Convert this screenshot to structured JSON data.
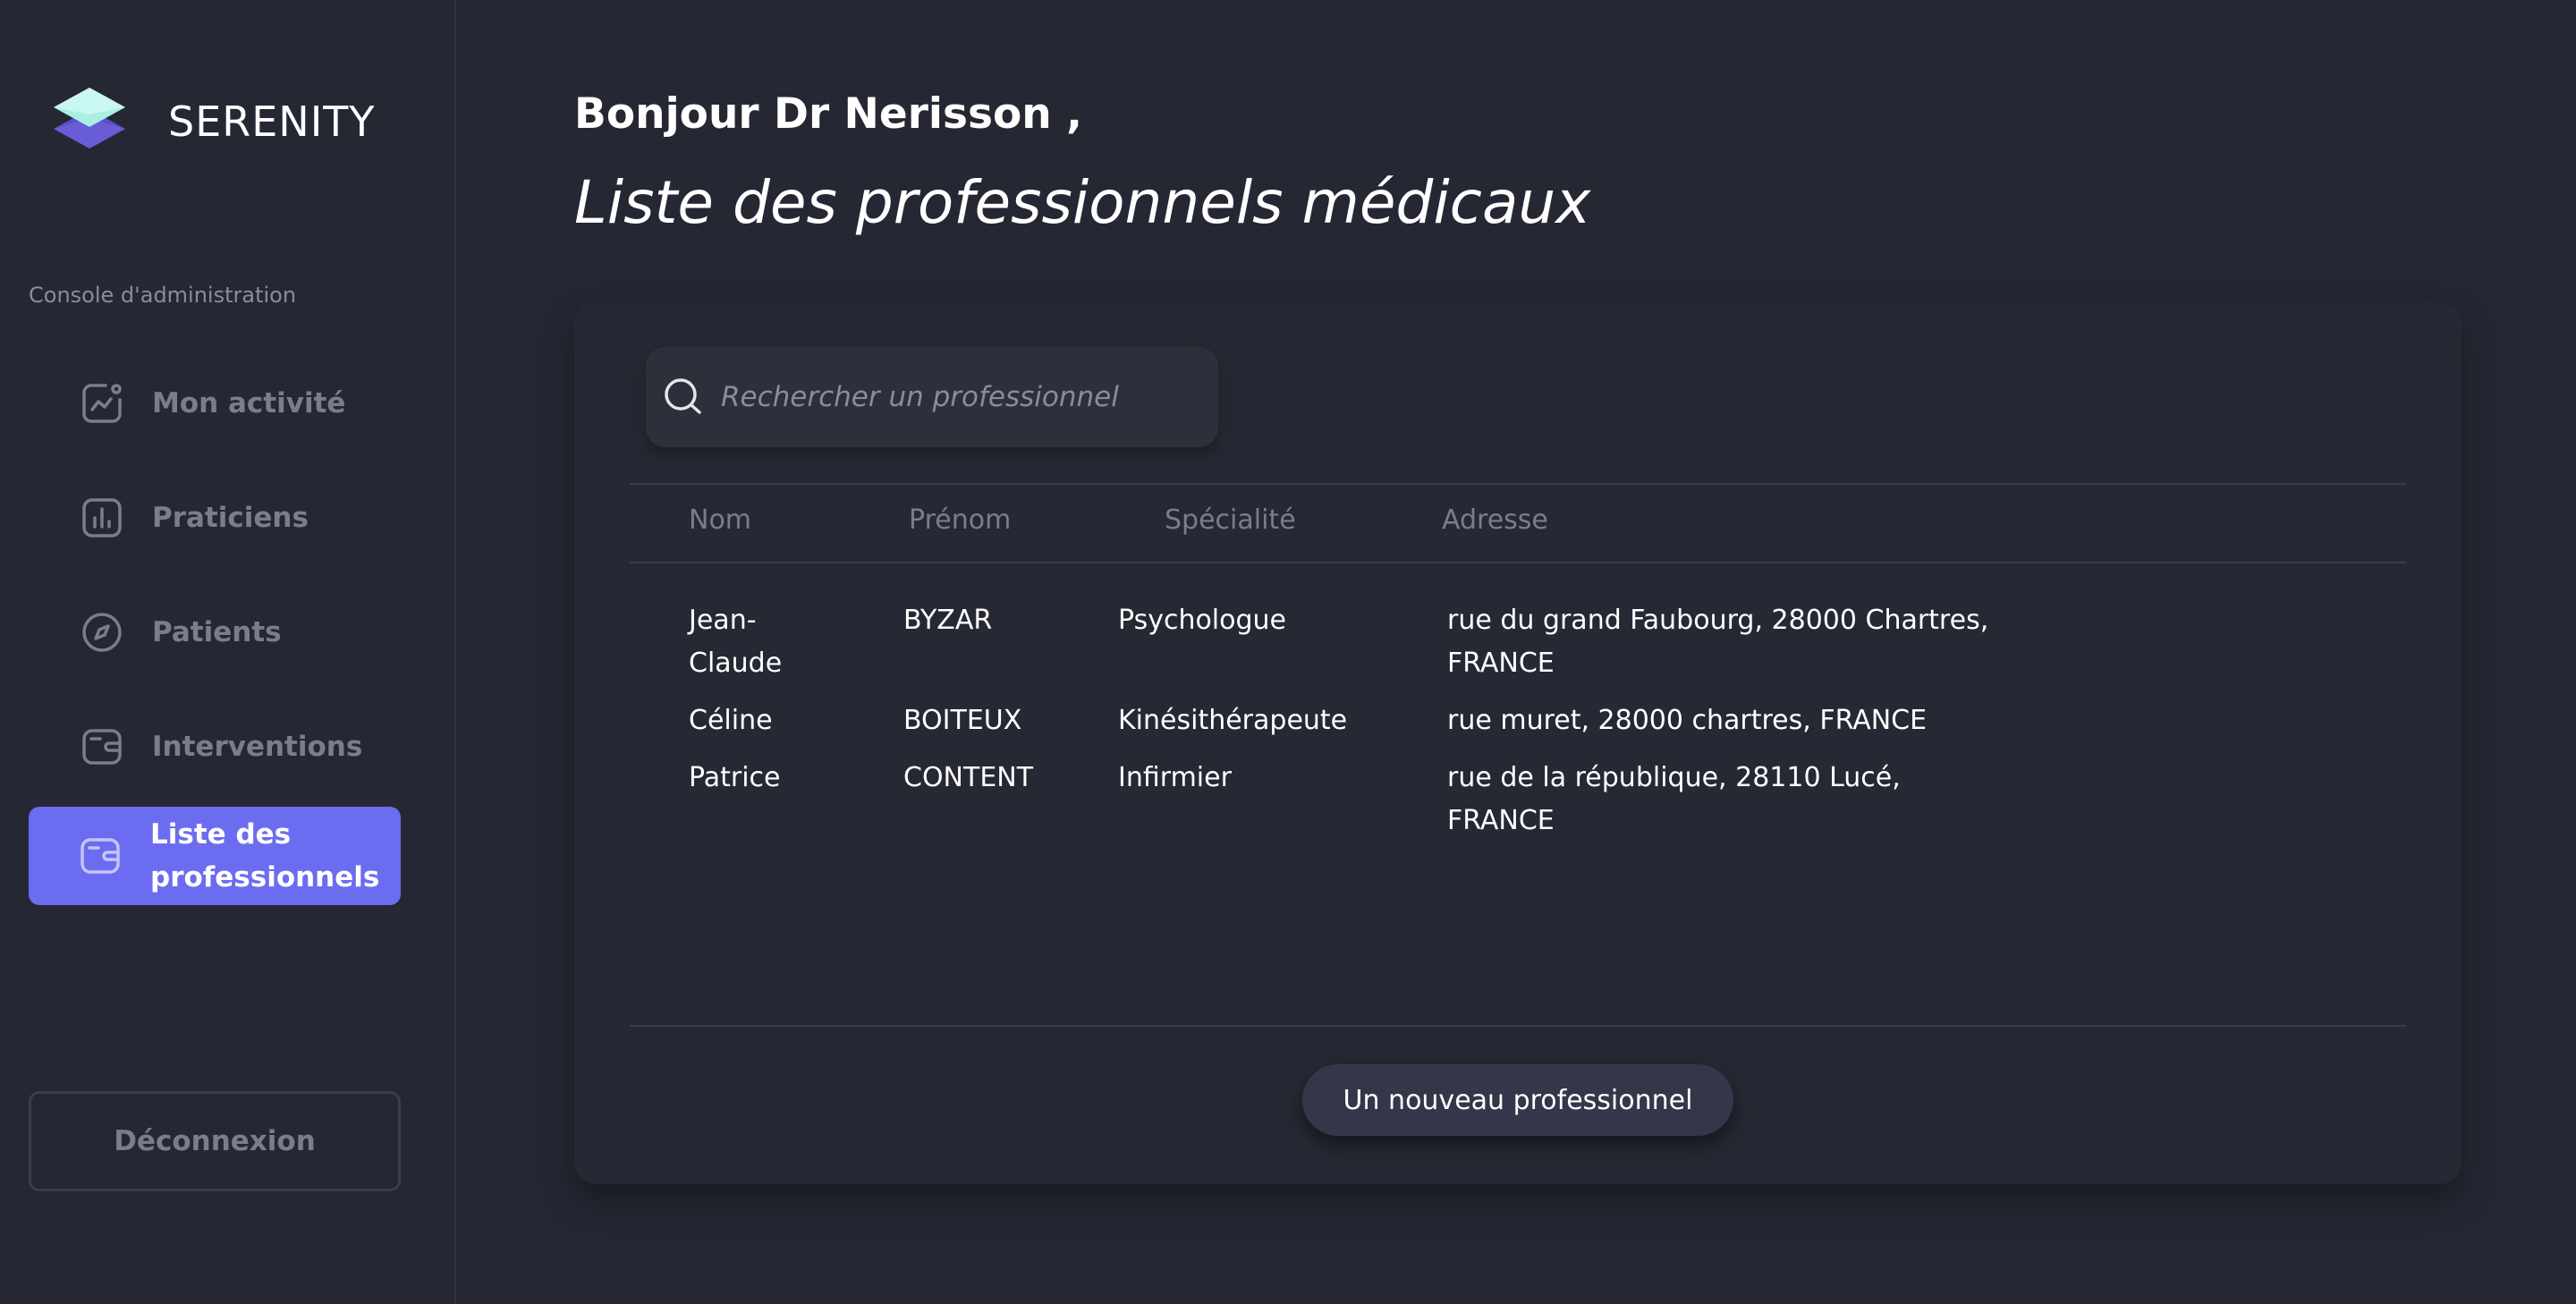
{
  "brand": {
    "name": "SERENITY",
    "logo_icon": "layers-logo-icon"
  },
  "sidebar": {
    "section_label": "Console d'administration",
    "items": [
      {
        "label": "Mon activité",
        "icon": "activity-chart-icon",
        "active": false
      },
      {
        "label": "Praticiens",
        "icon": "bar-chart-icon",
        "active": false
      },
      {
        "label": "Patients",
        "icon": "compass-icon",
        "active": false
      },
      {
        "label": "Interventions",
        "icon": "wallet-icon",
        "active": false
      },
      {
        "label": "Liste des professionnels",
        "icon": "wallet-icon",
        "active": true
      }
    ],
    "logout_label": "Déconnexion"
  },
  "header": {
    "greeting": "Bonjour Dr Nerisson ,",
    "title": "Liste des professionnels médicaux"
  },
  "search": {
    "placeholder": "Rechercher un professionnel",
    "value": ""
  },
  "table": {
    "columns": [
      "Nom",
      "Prénom",
      "Spécialité",
      "Adresse"
    ],
    "rows": [
      {
        "nom": "Jean-\nClaude",
        "prenom": "BYZAR",
        "specialite": "Psychologue",
        "adresse": "rue du grand Faubourg, 28000 Chartres,\nFRANCE"
      },
      {
        "nom": "Céline",
        "prenom": "BOITEUX",
        "specialite": "Kinésithérapeute",
        "adresse": "rue muret, 28000 chartres, FRANCE"
      },
      {
        "nom": "Patrice",
        "prenom": "CONTENT",
        "specialite": "Infirmier",
        "adresse": "rue de la république, 28110 Lucé,\nFRANCE"
      }
    ]
  },
  "actions": {
    "new_professional_label": "Un nouveau professionnel"
  },
  "colors": {
    "background": "#252733",
    "accent": "#6c6cf0",
    "muted_text": "#7b7e8a",
    "card": "#262833"
  }
}
